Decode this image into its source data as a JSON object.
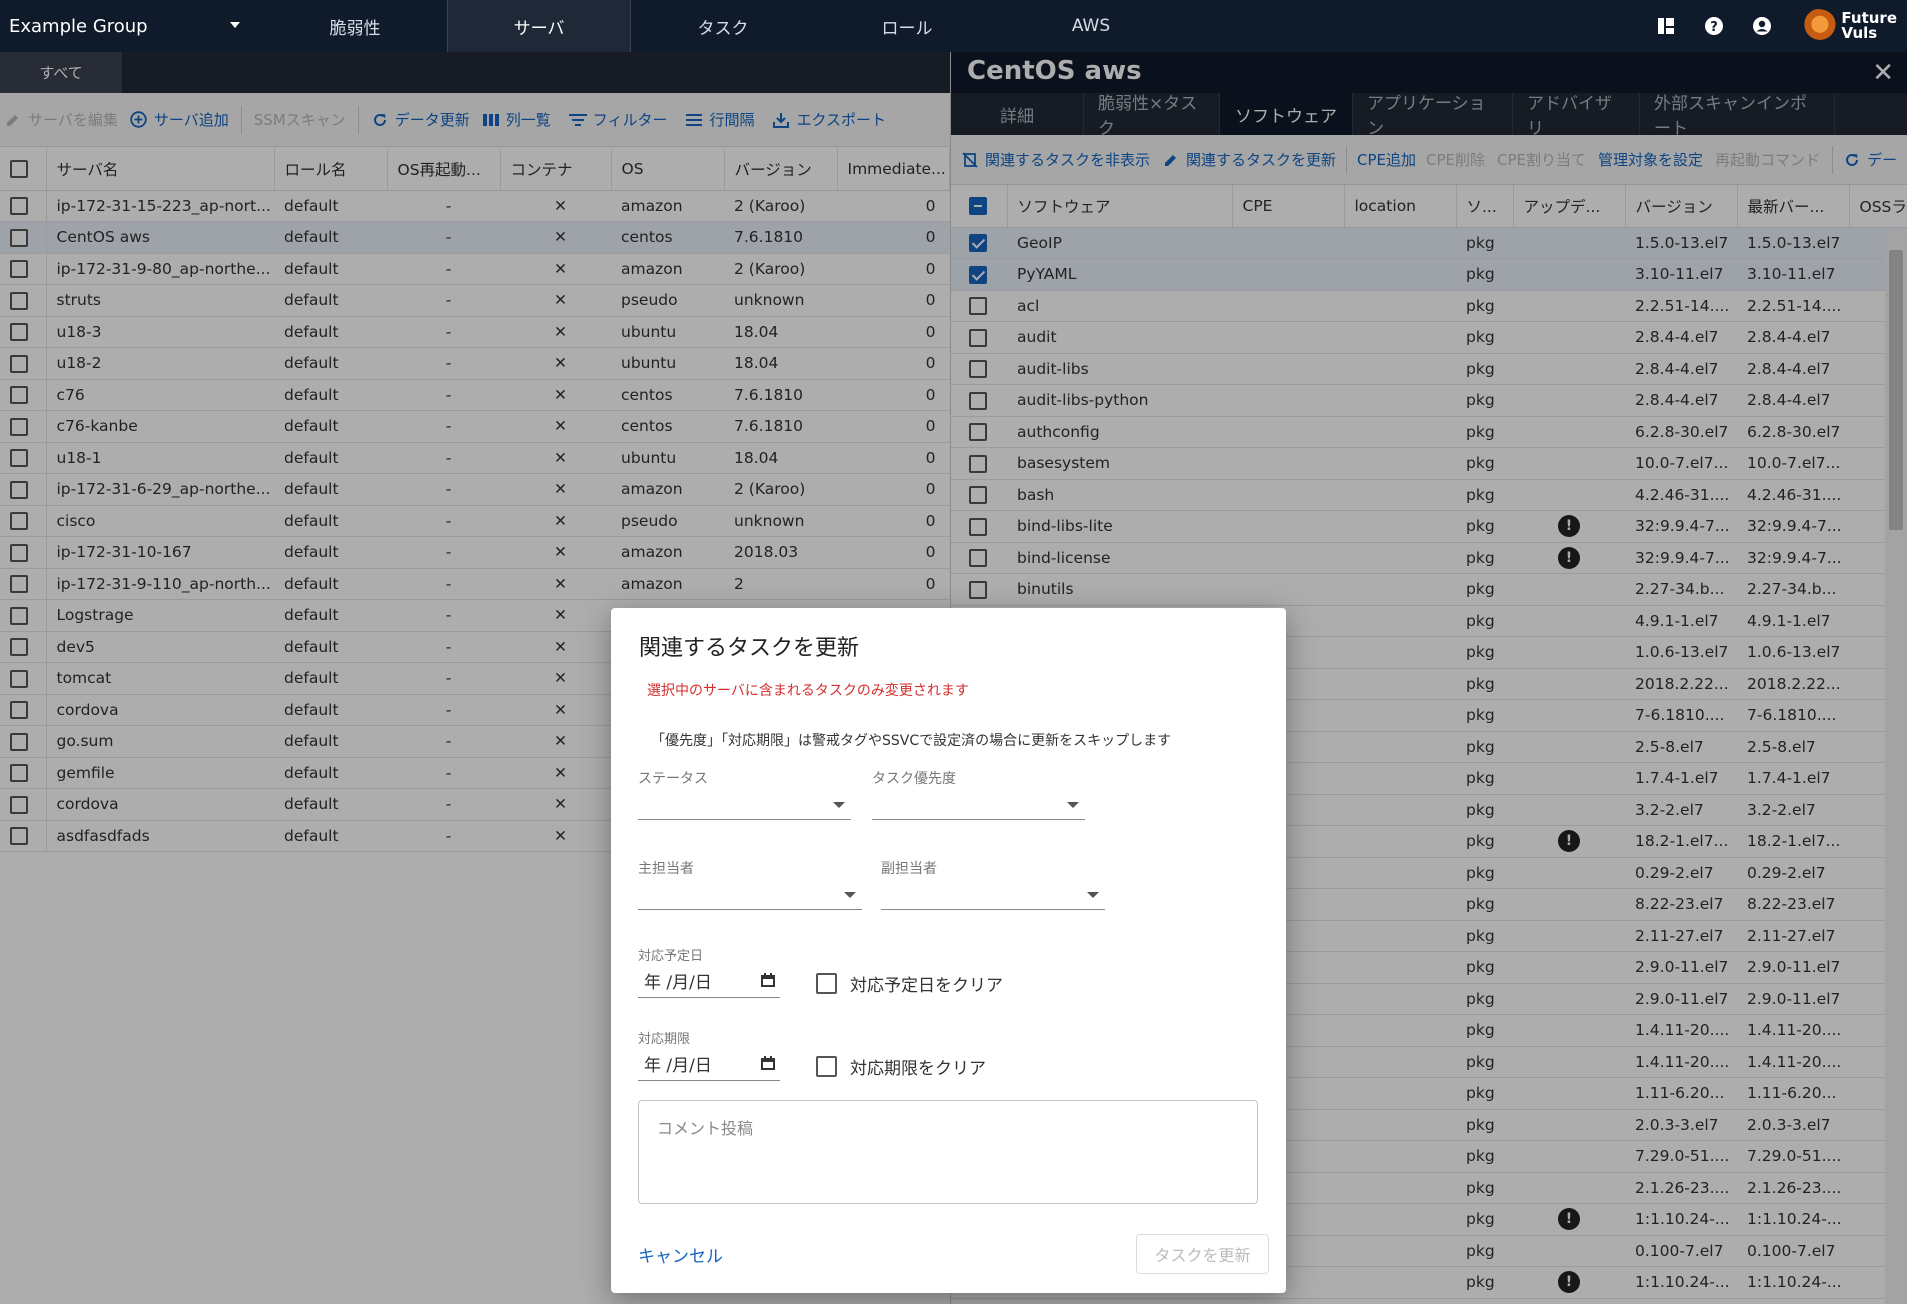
{
  "topnav": {
    "group": "Example Group",
    "tabs": [
      "脆弱性",
      "サーバ",
      "タスク",
      "ロール",
      "AWS"
    ],
    "active_tab": 1,
    "logo_text_1": "Future",
    "logo_text_2": "Vuls"
  },
  "left": {
    "subtab": "すべて",
    "toolbar": {
      "edit": "サーバを編集",
      "add": "サーバ追加",
      "ssm": "SSMスキャン",
      "refresh": "データ更新",
      "columns": "列一覧",
      "filter": "フィルター",
      "rowspacing": "行間隔",
      "export": "エクスポート"
    },
    "columns": [
      "サーバ名",
      "ロール名",
      "OS再起動...",
      "コンテナ",
      "OS",
      "バージョン",
      "Immediate..."
    ],
    "rows": [
      {
        "name": "ip-172-31-15-223_ap-nort...",
        "role": "default",
        "reboot": "-",
        "os": "amazon",
        "version": "2 (Karoo)",
        "imm": "0"
      },
      {
        "name": "CentOS aws",
        "role": "default",
        "reboot": "-",
        "os": "centos",
        "version": "7.6.1810",
        "imm": "0"
      },
      {
        "name": "ip-172-31-9-80_ap-northe...",
        "role": "default",
        "reboot": "-",
        "os": "amazon",
        "version": "2 (Karoo)",
        "imm": "0"
      },
      {
        "name": "struts",
        "role": "default",
        "reboot": "-",
        "os": "pseudo",
        "version": "unknown",
        "imm": "0"
      },
      {
        "name": "u18-3",
        "role": "default",
        "reboot": "-",
        "os": "ubuntu",
        "version": "18.04",
        "imm": "0"
      },
      {
        "name": "u18-2",
        "role": "default",
        "reboot": "-",
        "os": "ubuntu",
        "version": "18.04",
        "imm": "0"
      },
      {
        "name": "c76",
        "role": "default",
        "reboot": "-",
        "os": "centos",
        "version": "7.6.1810",
        "imm": "0"
      },
      {
        "name": "c76-kanbe",
        "role": "default",
        "reboot": "-",
        "os": "centos",
        "version": "7.6.1810",
        "imm": "0"
      },
      {
        "name": "u18-1",
        "role": "default",
        "reboot": "-",
        "os": "ubuntu",
        "version": "18.04",
        "imm": "0"
      },
      {
        "name": "ip-172-31-6-29_ap-northe...",
        "role": "default",
        "reboot": "-",
        "os": "amazon",
        "version": "2 (Karoo)",
        "imm": "0"
      },
      {
        "name": "cisco",
        "role": "default",
        "reboot": "-",
        "os": "pseudo",
        "version": "unknown",
        "imm": "0"
      },
      {
        "name": "ip-172-31-10-167",
        "role": "default",
        "reboot": "-",
        "os": "amazon",
        "version": "2018.03",
        "imm": "0"
      },
      {
        "name": "ip-172-31-9-110_ap-north...",
        "role": "default",
        "reboot": "-",
        "os": "amazon",
        "version": "2",
        "imm": "0"
      },
      {
        "name": "Logstrage",
        "role": "default",
        "reboot": "-",
        "os": "",
        "version": "",
        "imm": ""
      },
      {
        "name": "dev5",
        "role": "default",
        "reboot": "-",
        "os": "",
        "version": "",
        "imm": ""
      },
      {
        "name": "tomcat",
        "role": "default",
        "reboot": "-",
        "os": "",
        "version": "",
        "imm": ""
      },
      {
        "name": "cordova",
        "role": "default",
        "reboot": "-",
        "os": "",
        "version": "",
        "imm": ""
      },
      {
        "name": "go.sum",
        "role": "default",
        "reboot": "-",
        "os": "",
        "version": "",
        "imm": ""
      },
      {
        "name": "gemfile",
        "role": "default",
        "reboot": "-",
        "os": "",
        "version": "",
        "imm": ""
      },
      {
        "name": "cordova",
        "role": "default",
        "reboot": "-",
        "os": "",
        "version": "",
        "imm": ""
      },
      {
        "name": "asdfasdfads",
        "role": "default",
        "reboot": "-",
        "os": "",
        "version": "",
        "imm": ""
      }
    ],
    "selected_row": 1
  },
  "detail": {
    "title": "CentOS aws",
    "close": "✕",
    "tabs": [
      "詳細",
      "脆弱性×タスク",
      "ソフトウェア",
      "アプリケーション",
      "アドバイザリ",
      "外部スキャンインポート"
    ],
    "active_tab": 2,
    "toolbar": {
      "hide_tasks": "関連するタスクを非表示",
      "update_tasks": "関連するタスクを更新",
      "cpe_add": "CPE追加",
      "cpe_delete": "CPE削除",
      "cpe_assign": "CPE割り当て",
      "managed": "管理対象を設定",
      "restart_cmd": "再起動コマンド",
      "refresh": "デー"
    },
    "columns": [
      "ソフトウェア",
      "CPE",
      "location",
      "ソ...",
      "アップデ...",
      "バージョン",
      "最新バー...",
      "OSSラ"
    ],
    "rows": [
      {
        "name": "GeoIP",
        "type": "pkg",
        "warn": false,
        "version": "1.5.0-13.el7",
        "latest": "1.5.0-13.el7",
        "checked": true
      },
      {
        "name": "PyYAML",
        "type": "pkg",
        "warn": false,
        "version": "3.10-11.el7",
        "latest": "3.10-11.el7",
        "checked": true
      },
      {
        "name": "acl",
        "type": "pkg",
        "warn": false,
        "version": "2.2.51-14....",
        "latest": "2.2.51-14....",
        "checked": false
      },
      {
        "name": "audit",
        "type": "pkg",
        "warn": false,
        "version": "2.8.4-4.el7",
        "latest": "2.8.4-4.el7",
        "checked": false
      },
      {
        "name": "audit-libs",
        "type": "pkg",
        "warn": false,
        "version": "2.8.4-4.el7",
        "latest": "2.8.4-4.el7",
        "checked": false
      },
      {
        "name": "audit-libs-python",
        "type": "pkg",
        "warn": false,
        "version": "2.8.4-4.el7",
        "latest": "2.8.4-4.el7",
        "checked": false
      },
      {
        "name": "authconfig",
        "type": "pkg",
        "warn": false,
        "version": "6.2.8-30.el7",
        "latest": "6.2.8-30.el7",
        "checked": false
      },
      {
        "name": "basesystem",
        "type": "pkg",
        "warn": false,
        "version": "10.0-7.el7...",
        "latest": "10.0-7.el7...",
        "checked": false
      },
      {
        "name": "bash",
        "type": "pkg",
        "warn": false,
        "version": "4.2.46-31....",
        "latest": "4.2.46-31....",
        "checked": false
      },
      {
        "name": "bind-libs-lite",
        "type": "pkg",
        "warn": true,
        "version": "32:9.9.4-7...",
        "latest": "32:9.9.4-7...",
        "checked": false
      },
      {
        "name": "bind-license",
        "type": "pkg",
        "warn": true,
        "version": "32:9.9.4-7...",
        "latest": "32:9.9.4-7...",
        "checked": false
      },
      {
        "name": "binutils",
        "type": "pkg",
        "warn": false,
        "version": "2.27-34.b...",
        "latest": "2.27-34.b...",
        "checked": false
      },
      {
        "name": "",
        "type": "pkg",
        "warn": false,
        "version": "4.9.1-1.el7",
        "latest": "4.9.1-1.el7",
        "checked": false
      },
      {
        "name": "",
        "type": "pkg",
        "warn": false,
        "version": "1.0.6-13.el7",
        "latest": "1.0.6-13.el7",
        "checked": false
      },
      {
        "name": "",
        "type": "pkg",
        "warn": false,
        "version": "2018.2.22...",
        "latest": "2018.2.22...",
        "checked": false
      },
      {
        "name": "",
        "type": "pkg",
        "warn": false,
        "version": "7-6.1810....",
        "latest": "7-6.1810....",
        "checked": false
      },
      {
        "name": "",
        "type": "pkg",
        "warn": false,
        "version": "2.5-8.el7",
        "latest": "2.5-8.el7",
        "checked": false
      },
      {
        "name": "",
        "type": "pkg",
        "warn": false,
        "version": "1.7.4-1.el7",
        "latest": "1.7.4-1.el7",
        "checked": false
      },
      {
        "name": "",
        "type": "pkg",
        "warn": false,
        "version": "3.2-2.el7",
        "latest": "3.2-2.el7",
        "checked": false
      },
      {
        "name": "",
        "type": "pkg",
        "warn": true,
        "version": "18.2-1.el7...",
        "latest": "18.2-1.el7...",
        "checked": false
      },
      {
        "name": "",
        "type": "pkg",
        "warn": false,
        "version": "0.29-2.el7",
        "latest": "0.29-2.el7",
        "checked": false
      },
      {
        "name": "",
        "type": "pkg",
        "warn": false,
        "version": "8.22-23.el7",
        "latest": "8.22-23.el7",
        "checked": false
      },
      {
        "name": "",
        "type": "pkg",
        "warn": false,
        "version": "2.11-27.el7",
        "latest": "2.11-27.el7",
        "checked": false
      },
      {
        "name": "",
        "type": "pkg",
        "warn": false,
        "version": "2.9.0-11.el7",
        "latest": "2.9.0-11.el7",
        "checked": false
      },
      {
        "name": "",
        "type": "pkg",
        "warn": false,
        "version": "2.9.0-11.el7",
        "latest": "2.9.0-11.el7",
        "checked": false
      },
      {
        "name": "",
        "type": "pkg",
        "warn": false,
        "version": "1.4.11-20....",
        "latest": "1.4.11-20....",
        "checked": false
      },
      {
        "name": "",
        "type": "pkg",
        "warn": false,
        "version": "1.4.11-20....",
        "latest": "1.4.11-20....",
        "checked": false
      },
      {
        "name": "",
        "type": "pkg",
        "warn": false,
        "version": "1.11-6.20...",
        "latest": "1.11-6.20...",
        "checked": false
      },
      {
        "name": "",
        "type": "pkg",
        "warn": false,
        "version": "2.0.3-3.el7",
        "latest": "2.0.3-3.el7",
        "checked": false
      },
      {
        "name": "",
        "type": "pkg",
        "warn": false,
        "version": "7.29.0-51....",
        "latest": "7.29.0-51....",
        "checked": false
      },
      {
        "name": "",
        "type": "pkg",
        "warn": false,
        "version": "2.1.26-23....",
        "latest": "2.1.26-23....",
        "checked": false
      },
      {
        "name": "",
        "type": "pkg",
        "warn": true,
        "version": "1:1.10.24-...",
        "latest": "1:1.10.24-...",
        "checked": false
      },
      {
        "name": "",
        "type": "pkg",
        "warn": false,
        "version": "0.100-7.el7",
        "latest": "0.100-7.el7",
        "checked": false
      },
      {
        "name": "",
        "type": "pkg",
        "warn": true,
        "version": "1:1.10.24-...",
        "latest": "1:1.10.24-...",
        "checked": false
      }
    ]
  },
  "dialog": {
    "title": "関連するタスクを更新",
    "warning": "選択中のサーバに含まれるタスクのみ変更されます",
    "note": "「優先度」「対応期限」は警戒タグやSSVCで設定済の場合に更新をスキップします",
    "status_label": "ステータス",
    "priority_label": "タスク優先度",
    "main_assignee_label": "主担当者",
    "sub_assignee_label": "副担当者",
    "plan_date_label": "対応予定日",
    "plan_date_placeholder": "年 /月/日",
    "plan_date_clear": "対応予定日をクリア",
    "due_label": "対応期限",
    "due_placeholder": "年 /月/日",
    "due_clear": "対応期限をクリア",
    "comment_placeholder": "コメント投稿",
    "cancel": "キャンセル",
    "submit": "タスクを更新"
  }
}
